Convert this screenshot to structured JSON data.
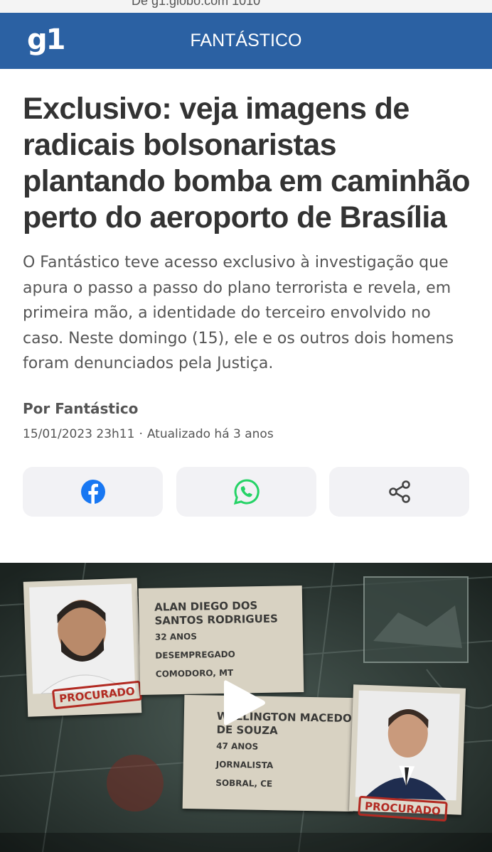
{
  "browser": {
    "url_text": "De g1.globo.com 1010"
  },
  "header": {
    "logo": "g1",
    "section": "FANTÁSTICO"
  },
  "article": {
    "headline": "Exclusivo: veja imagens de radicais bolsonaristas plantando bomba em caminhão perto do aeroporto de Brasília",
    "summary": "O Fantástico teve acesso exclusivo à investigação que apura o passo a passo do plano terrorista e revela, em primeira mão, a identidade do terceiro envolvido no caso. Neste domingo (15), ele e os outros dois homens foram denunciados pela Justiça.",
    "byline": "Por Fantástico",
    "published": "15/01/2023 23h11",
    "separator": "·",
    "updated": "Atualizado há 3 anos"
  },
  "share": {
    "buttons": [
      {
        "icon": "facebook-icon",
        "color": "#1877f2"
      },
      {
        "icon": "whatsapp-icon",
        "color": "#25d366"
      },
      {
        "icon": "share-icon",
        "color": "#444444"
      }
    ]
  },
  "video": {
    "suspect1": {
      "name": "ALAN DIEGO DOS SANTOS RODRIGUES",
      "age": "32 ANOS",
      "job": "DESEMPREGADO",
      "city": "COMODORO, MT",
      "stamp": "PROCURADO"
    },
    "suspect2": {
      "name": "WELLINGTON MACEDO DE SOUZA",
      "age": "47 ANOS",
      "job": "JORNALISTA",
      "city": "SOBRAL, CE",
      "stamp": "PROCURADO"
    },
    "play_icon": "play-icon"
  },
  "colors": {
    "header_bg": "#2b61a3",
    "text_dark": "#333333",
    "text_muted": "#555555",
    "button_bg": "#f2f2f5"
  }
}
